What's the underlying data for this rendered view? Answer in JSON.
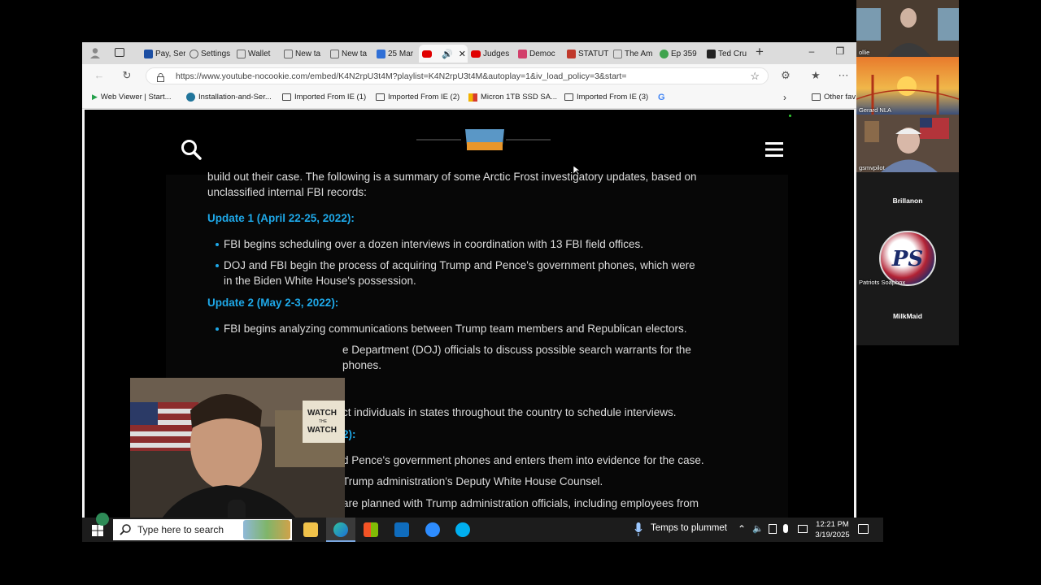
{
  "tabs": [
    {
      "label": "Pay, Ser",
      "color": "#1d4fa3"
    },
    {
      "label": "Settings",
      "color": "#666666"
    },
    {
      "label": "Wallet",
      "color": "#666666"
    },
    {
      "label": "New ta",
      "color": "#666666"
    },
    {
      "label": "New ta",
      "color": "#666666"
    },
    {
      "label": "25 Mar",
      "color": "#2f6fd6"
    },
    {
      "label": "",
      "color": "#e00000"
    },
    {
      "label": "Judges",
      "color": "#e00000"
    },
    {
      "label": "Democ",
      "color": "#d23f6b"
    },
    {
      "label": "STATUT",
      "color": "#c0392b"
    },
    {
      "label": "The Am",
      "color": "#777777"
    },
    {
      "label": "Ep 359",
      "color": "#3fa34d"
    },
    {
      "label": "Ted Cru",
      "color": "#222222"
    }
  ],
  "address": {
    "url": "https://www.youtube-nocookie.com/embed/K4N2rpU3t4M?playlist=K4N2rpU3t4M&autoplay=1&iv_load_policy=3&start="
  },
  "favorites": [
    {
      "label": "Web Viewer | Start...",
      "icon": "play-icon"
    },
    {
      "label": "Installation-and-Ser...",
      "icon": "wordpress-icon"
    },
    {
      "label": "Imported From IE (1)",
      "icon": "folder-icon"
    },
    {
      "label": "Imported From IE (2)",
      "icon": "folder-icon"
    },
    {
      "label": "Micron 1TB SSD SA...",
      "icon": "store-icon"
    },
    {
      "label": "Imported From IE (3)",
      "icon": "folder-icon"
    },
    {
      "label": "",
      "icon": "google-icon"
    },
    {
      "label": "Other fav",
      "icon": "folder-icon"
    }
  ],
  "article": {
    "intro_line1": "build out their case. The following is a summary of some Arctic Frost investigatory updates, based on",
    "intro_line2": "unclassified internal FBI records:",
    "update1_heading": "Update 1 (April 22-25, 2022):",
    "update1_b1": "FBI begins scheduling over a dozen interviews in coordination with 13 FBI field offices.",
    "update1_b2_line1": "DOJ and FBI begin the process of acquiring Trump and Pence's government phones, which were",
    "update1_b2_line2": "in the Biden White House's possession.",
    "update2_heading": "Update 2 (May 2-3, 2022):",
    "update2_b1": "FBI begins analyzing communications between Trump team members and Republican electors.",
    "update2_b2_line1": "e Department (DOJ) officials to discuss possible search warrants for the",
    "update2_b2_line2": "phones.",
    "update3_b1": "ct individuals in states throughout the country to schedule interviews.",
    "update4_heading": "2):",
    "update4_b1": "d Pence's government phones and enters them into evidence for the case.",
    "update4_b2": "Trump administration's Deputy White House Counsel.",
    "update4_b3": "are planned with Trump administration officials, including employees from"
  },
  "webcam": {
    "sign_line1": "WATCH",
    "sign_line2": "THE",
    "sign_line3": "WATCH"
  },
  "taskbar": {
    "search_placeholder": "Type here to search",
    "weather": "Temps to plummet",
    "time": "12:21 PM",
    "date": "3/19/2025"
  },
  "zoom": {
    "p1": "ollie",
    "p2": "Gerard NLA",
    "p3": "gsmvpilot",
    "p4": "Brillanon",
    "p5_logo": "PS",
    "p5": "Patriots Soapbox",
    "p6": "MilkMaid"
  }
}
